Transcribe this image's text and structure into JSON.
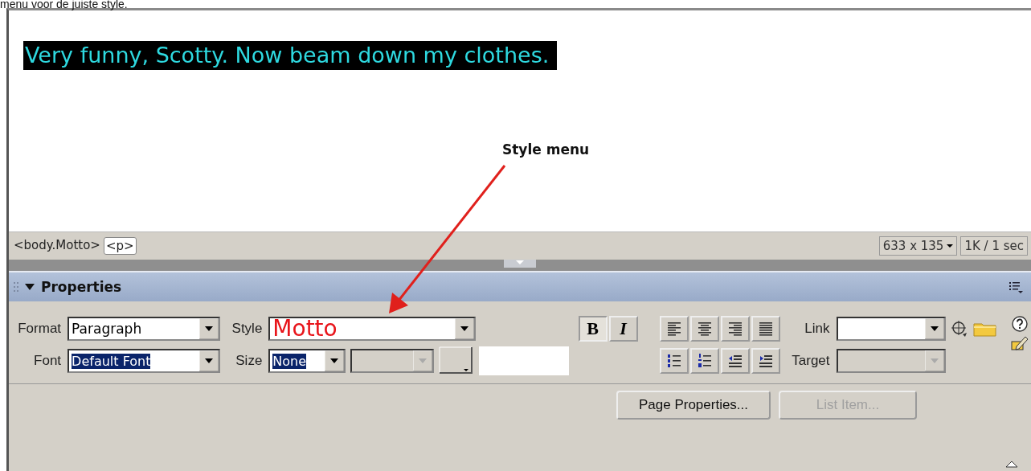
{
  "caption": "menu voor de juiste style.",
  "document": {
    "text": "Very funny, Scotty. Now beam down my clothes."
  },
  "annotation": {
    "label": "Style menu"
  },
  "status_bar": {
    "tags": [
      {
        "label": "<body.Motto>",
        "selected": false
      },
      {
        "label": "<p>",
        "selected": true
      }
    ],
    "window_size": "633 x 135",
    "download": "1K / 1 sec"
  },
  "properties": {
    "title": "Properties",
    "expanded": true,
    "format": {
      "label": "Format",
      "value": "Paragraph"
    },
    "font": {
      "label": "Font",
      "value": "Default Font"
    },
    "style": {
      "label": "Style",
      "value": "Motto"
    },
    "size": {
      "label": "Size",
      "value": "None"
    },
    "bold": {
      "label": "B",
      "pressed": true
    },
    "italic": {
      "label": "I",
      "pressed": false
    },
    "link": {
      "label": "Link"
    },
    "target": {
      "label": "Target",
      "disabled": true
    },
    "actions": [
      {
        "label": "Page Properties...",
        "disabled": false
      },
      {
        "label": "List Item...",
        "disabled": true
      }
    ]
  }
}
